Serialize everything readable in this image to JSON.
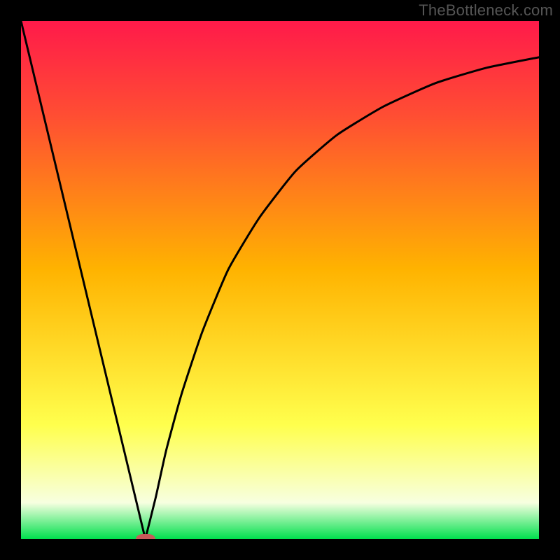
{
  "watermark": "TheBottleneck.com",
  "colors": {
    "frame_bg": "#000000",
    "grad_top": "#ff1a4a",
    "grad_midtop": "#ff4d33",
    "grad_mid": "#ffb300",
    "grad_midlow": "#ffff4d",
    "grad_lowwhite": "#f7ffe0",
    "grad_bottom": "#00e04d",
    "curve": "#000000",
    "marker": "#c85a5a"
  },
  "chart_data": {
    "type": "line",
    "title": "",
    "xlabel": "",
    "ylabel": "",
    "xlim": [
      0,
      100
    ],
    "ylim": [
      0,
      100
    ],
    "minimum_x": 24,
    "marker": {
      "x": 24,
      "y": 0
    },
    "curve_points": [
      {
        "x": 0,
        "y": 100
      },
      {
        "x": 6,
        "y": 75
      },
      {
        "x": 12,
        "y": 50
      },
      {
        "x": 18,
        "y": 25
      },
      {
        "x": 24,
        "y": 0
      },
      {
        "x": 26,
        "y": 8
      },
      {
        "x": 28,
        "y": 17
      },
      {
        "x": 31,
        "y": 28
      },
      {
        "x": 35,
        "y": 40
      },
      {
        "x": 40,
        "y": 52
      },
      {
        "x": 46,
        "y": 62
      },
      {
        "x": 53,
        "y": 71
      },
      {
        "x": 61,
        "y": 78
      },
      {
        "x": 70,
        "y": 83.5
      },
      {
        "x": 80,
        "y": 88
      },
      {
        "x": 90,
        "y": 91
      },
      {
        "x": 100,
        "y": 93
      }
    ],
    "annotations": []
  }
}
